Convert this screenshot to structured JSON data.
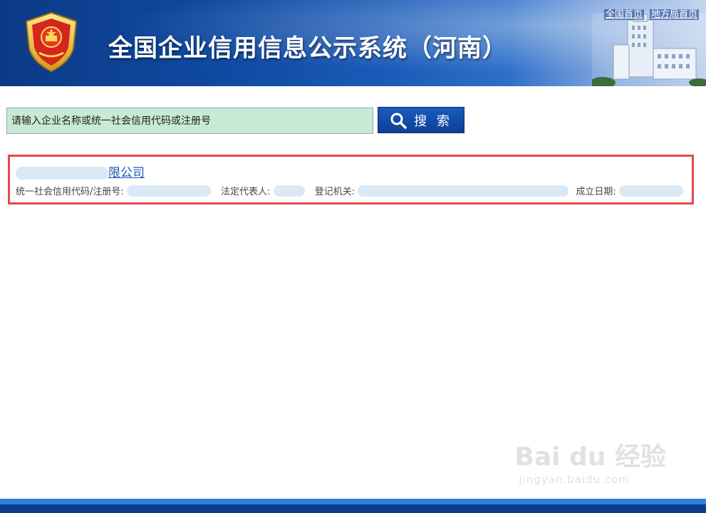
{
  "header": {
    "title": "全国企业信用信息公示系统（河南）",
    "links": [
      "全国首页",
      "地方局首页"
    ]
  },
  "search": {
    "placeholder": "请输入企业名称或统一社会信用代码或注册号",
    "button_label": "搜 索"
  },
  "result": {
    "company_name_visible": "限公司",
    "credit_code_label": "统一社会信用代码/注册号:",
    "legal_rep_label": "法定代表人:",
    "registration_authority_label": "登记机关:",
    "establish_date_label": "成立日期:"
  },
  "watermark": {
    "logo": "Bai du 经验",
    "sub": "jingyan.baidu.com"
  },
  "colors": {
    "header_blue": "#0f49a0",
    "search_bg": "#c8ead4",
    "button_blue": "#0d3f96",
    "highlight_red": "#e34a4a",
    "link_blue": "#1a56b0"
  }
}
